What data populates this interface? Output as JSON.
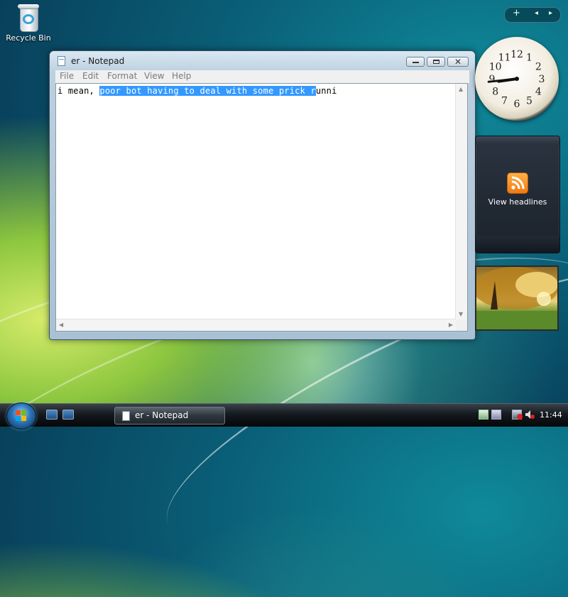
{
  "desktop": {
    "icons": [
      {
        "label": "Recycle Bin",
        "icon": "recycle-bin-icon"
      }
    ]
  },
  "notepad": {
    "title": "er - Notepad",
    "menu": [
      "File",
      "Edit",
      "Format",
      "View",
      "Help"
    ],
    "text_before": "i mean, ",
    "text_selected": "poor bot having to deal with some prick r",
    "text_after": "unni",
    "selection_color": "#3399ff"
  },
  "sidebar": {
    "clock": {
      "hour": 8,
      "minute": 44,
      "numerals": [
        "12",
        "1",
        "2",
        "3",
        "4",
        "5",
        "6",
        "7",
        "8",
        "9",
        "10",
        "11"
      ]
    },
    "feed_label": "View headlines",
    "controls": {
      "add": "+",
      "prev": "◂",
      "next": "▸"
    }
  },
  "taskbar": {
    "task_button_label": "er - Notepad",
    "time": "11:44"
  }
}
